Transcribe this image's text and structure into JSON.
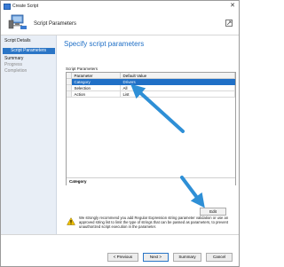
{
  "window": {
    "title": "Create Script"
  },
  "header": {
    "title": "Script Parameters"
  },
  "nav": {
    "items": [
      {
        "label": "Script Details",
        "state": "section"
      },
      {
        "label": "Script Parameters",
        "state": "selected"
      },
      {
        "label": "Summary",
        "state": "section"
      },
      {
        "label": "Progress",
        "state": "disabled"
      },
      {
        "label": "Completion",
        "state": "disabled"
      }
    ]
  },
  "main": {
    "title": "Specify script parameters",
    "group_label": "Script Parameters",
    "table": {
      "columns": [
        "Parameter",
        "Default Value"
      ],
      "rows": [
        {
          "parameter": "Category",
          "default_value": "Drivers",
          "selected": true
        },
        {
          "parameter": "Selection",
          "default_value": "All",
          "selected": false
        },
        {
          "parameter": "Action",
          "default_value": "List",
          "selected": false
        }
      ]
    },
    "description_label": "Category",
    "edit_button": "Edit",
    "warning_text": "We strongly recommend you add Regular Expression string parameter validation or use an approved string list to limit the type of strings that can be passed as parameters, to prevent unauthorized script execution in the parameter."
  },
  "footer": {
    "previous": "< Previous",
    "next": "Next >",
    "summary": "Summary",
    "cancel": "Cancel"
  },
  "colors": {
    "accent": "#1f6fc6",
    "arrow": "#2e8fd6",
    "nav_bg": "#e8eef6"
  }
}
